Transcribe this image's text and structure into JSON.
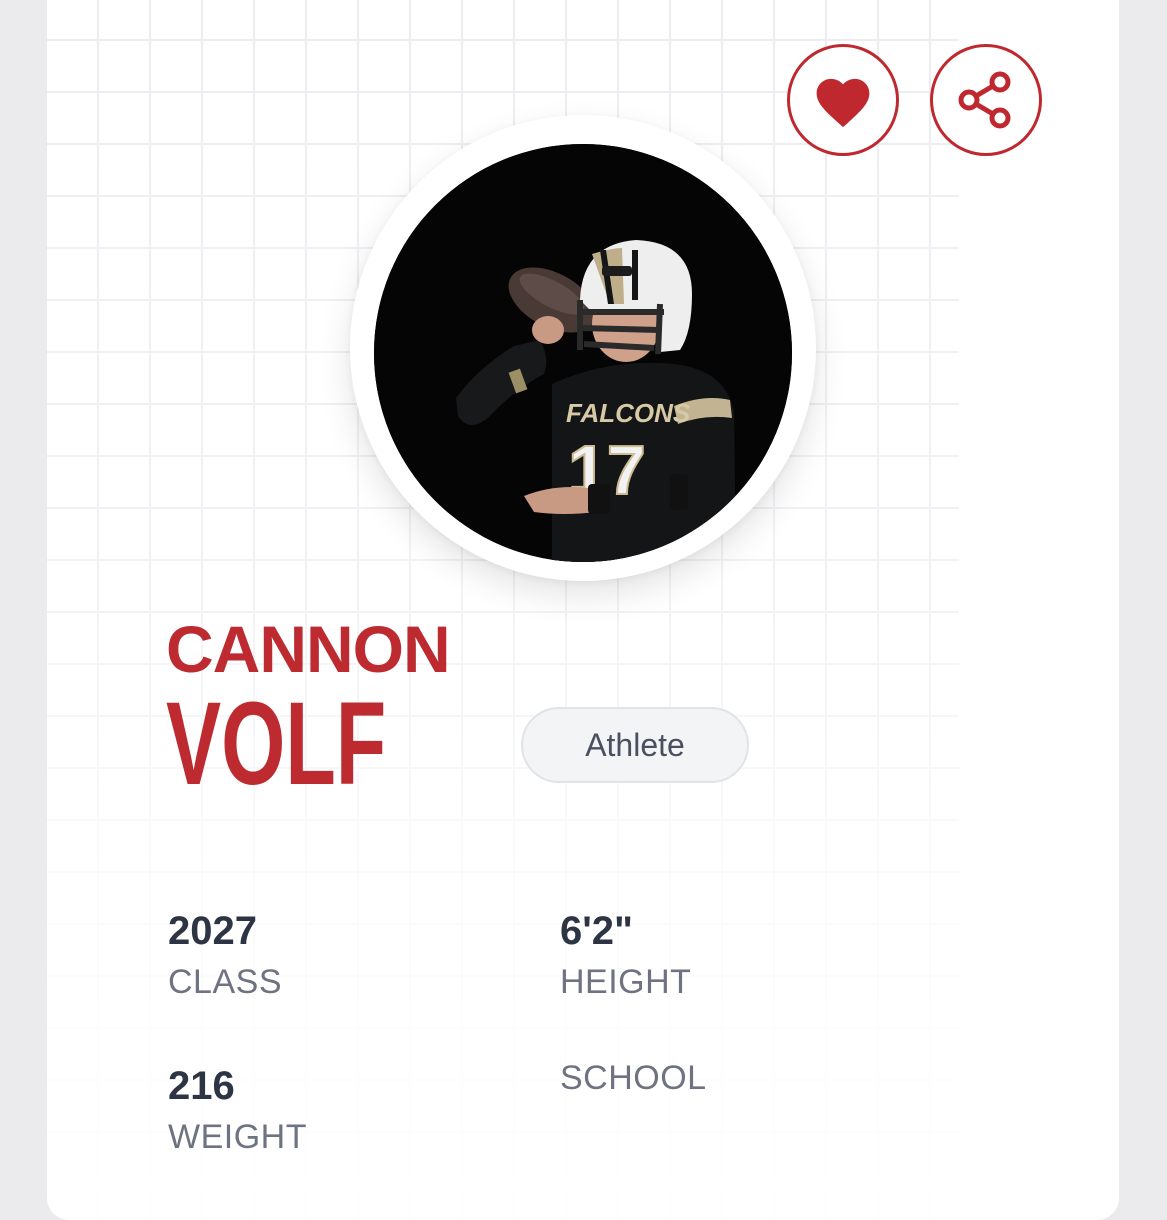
{
  "actions": {
    "favorite_icon": "heart-icon",
    "share_icon": "share-icon",
    "accent_color": "#c0282f"
  },
  "player": {
    "first_name": "CANNON",
    "last_name": "VOLF",
    "position_badge": "Athlete",
    "jersey_team": "FALCONS",
    "jersey_number": "17",
    "name_color": "#bd2b31"
  },
  "stats": {
    "class": {
      "value": "2027",
      "label": "CLASS"
    },
    "height": {
      "value": "6'2\"",
      "label": "HEIGHT"
    },
    "weight": {
      "value": "216",
      "label": "WEIGHT"
    },
    "school": {
      "value": "",
      "label": "SCHOOL"
    }
  }
}
